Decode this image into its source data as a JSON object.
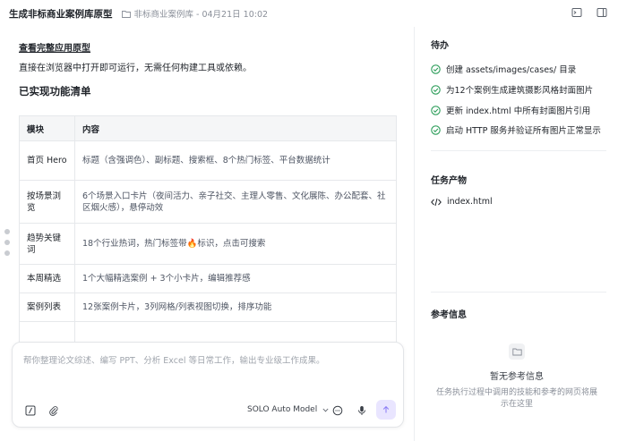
{
  "window": {
    "title": "生成非标商业案例库原型",
    "path": "非标商业案例库 - 04月21日 10:02"
  },
  "main": {
    "link": "查看完整应用原型",
    "description": "直接在浏览器中打开即可运行，无需任何构建工具或依赖。",
    "heading": "已实现功能清单",
    "table": {
      "headers": [
        "模块",
        "内容"
      ],
      "rows": [
        [
          "首页 Hero",
          "标题（含强调色）、副标题、搜索框、8个热门标签、平台数据统计"
        ],
        [
          "按场景浏览",
          "6个场景入口卡片（夜间活力、亲子社交、主理人零售、文化展陈、办公配套、社区烟火感），悬停动效"
        ],
        [
          "趋势关键词",
          "18个行业热词，热门标签带🔥标识，点击可搜索"
        ],
        [
          "本周精选",
          "1个大幅精选案例 + 3个小卡片，编辑推荐感"
        ],
        [
          "案例列表",
          "12张案例卡片，3列网格/列表视图切换，排序功能"
        ],
        [
          "",
          ""
        ]
      ]
    }
  },
  "chat": {
    "placeholder": "帮你整理论文综述、编写 PPT、分析 Excel 等日常工作，输出专业级工作成果。",
    "model": "SOLO Auto Model",
    "accent": "#e9e5ff"
  },
  "sidebar": {
    "todo_title": "待办",
    "todos": [
      "创建 assets/images/cases/ 目录",
      "为12个案例生成建筑摄影风格封面图片",
      "更新 index.html 中所有封面图片引用",
      "启动 HTTP 服务并验证所有图片正常显示"
    ],
    "artifacts_title": "任务产物",
    "artifact_file": "index.html",
    "reference_title": "参考信息",
    "reference_empty_title": "暂无参考信息",
    "reference_empty_desc": "任务执行过程中调用的技能和参考的网页将展示在这里",
    "check_color": "#2e9e5b"
  }
}
